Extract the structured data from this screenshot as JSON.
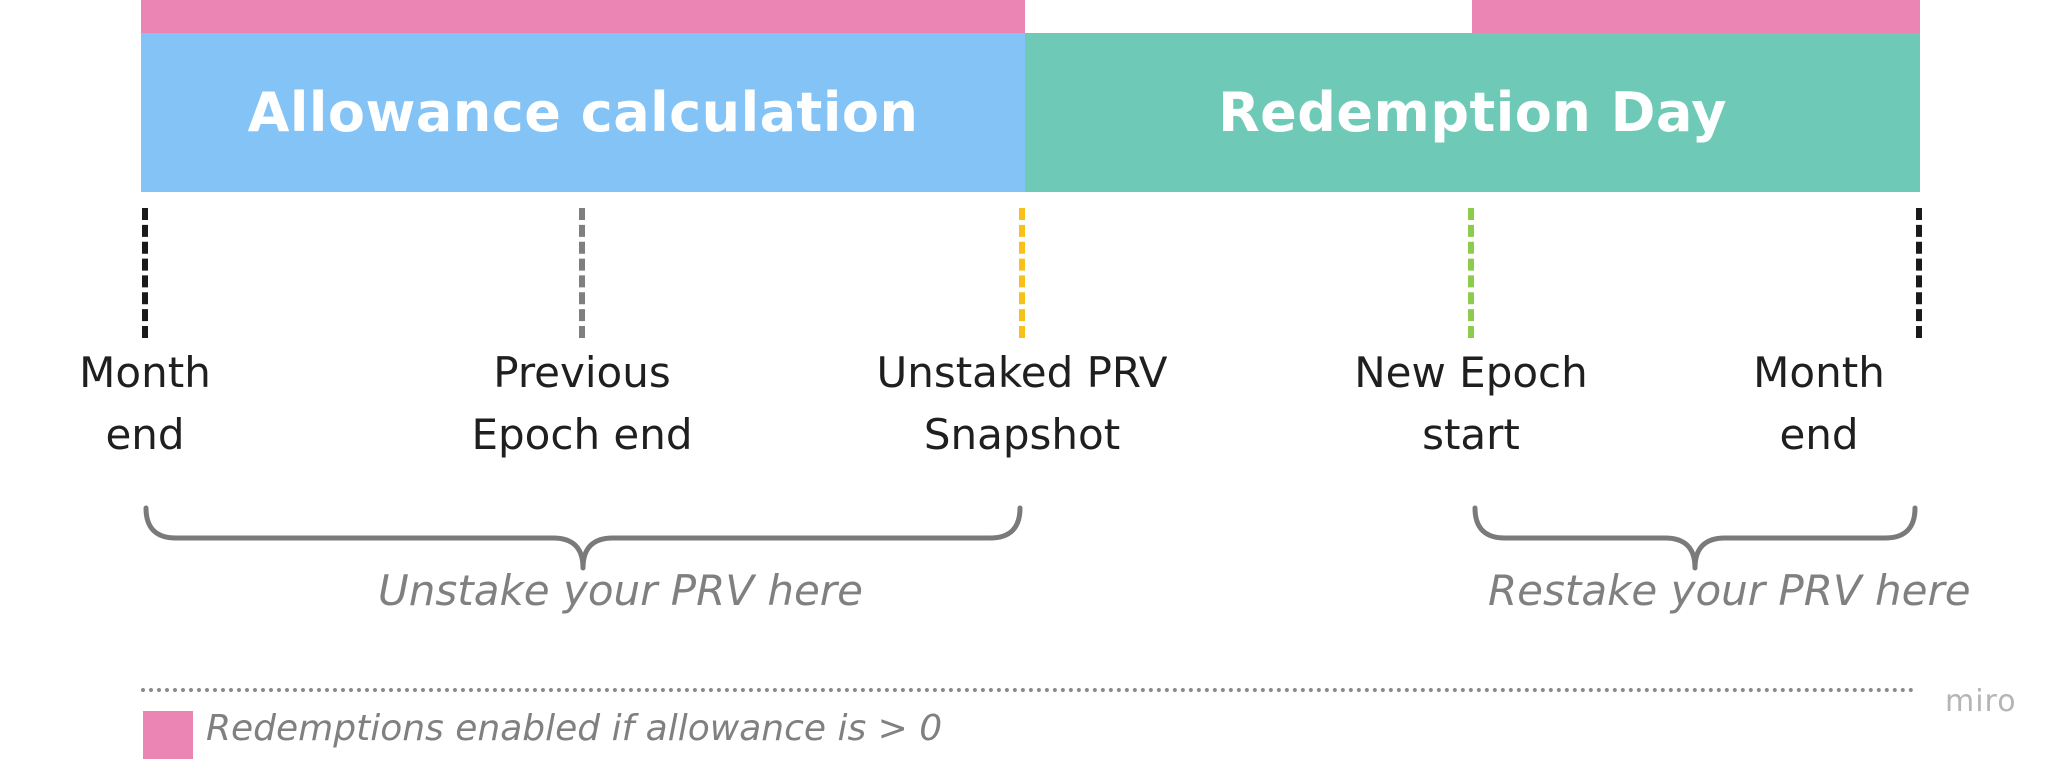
{
  "bands": [
    {
      "label": "Allowance calculation",
      "color": "#84C3F5"
    },
    {
      "label": "Redemption Day",
      "color": "#6ECAB6"
    }
  ],
  "redemption_bar_color": "#EB86B4",
  "markers": [
    {
      "label": "Month\nend",
      "color": "#1a1a1a"
    },
    {
      "label": "Previous\nEpoch end",
      "color": "#7f7f7f"
    },
    {
      "label": "Unstaked PRV\nSnapshot",
      "color": "#F6C21A"
    },
    {
      "label": "New Epoch\nstart",
      "color": "#8CCB4E"
    },
    {
      "label": "Month\nend",
      "color": "#1a1a1a"
    }
  ],
  "braces": [
    {
      "caption": "Unstake your PRV here"
    },
    {
      "caption": "Restake your PRV here"
    }
  ],
  "legend": {
    "label": "Redemptions enabled if allowance is > 0",
    "color": "#EB86B4"
  },
  "watermark": "miro"
}
